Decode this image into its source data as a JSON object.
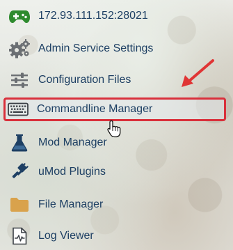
{
  "menu": {
    "items": [
      {
        "label": "172.93.111.152:28021",
        "icon": "gamepad-icon"
      },
      {
        "label": "Admin Service Settings",
        "icon": "gears-icon"
      },
      {
        "label": "Configuration Files",
        "icon": "sliders-icon"
      },
      {
        "label": "Commandline Manager",
        "icon": "keyboard-icon",
        "selected": true
      },
      {
        "label": "Mod Manager",
        "icon": "flask-icon"
      },
      {
        "label": "uMod Plugins",
        "icon": "plug-icon"
      },
      {
        "label": "File Manager",
        "icon": "folder-icon"
      },
      {
        "label": "Log Viewer",
        "icon": "log-file-icon"
      }
    ]
  },
  "colors": {
    "label": "#1d3f63",
    "highlight_border": "#d9303b",
    "gamepad": "#2e8b2e",
    "gear": "#6b6f73",
    "flask": "#1d3f63",
    "folder": "#d9a24c"
  }
}
